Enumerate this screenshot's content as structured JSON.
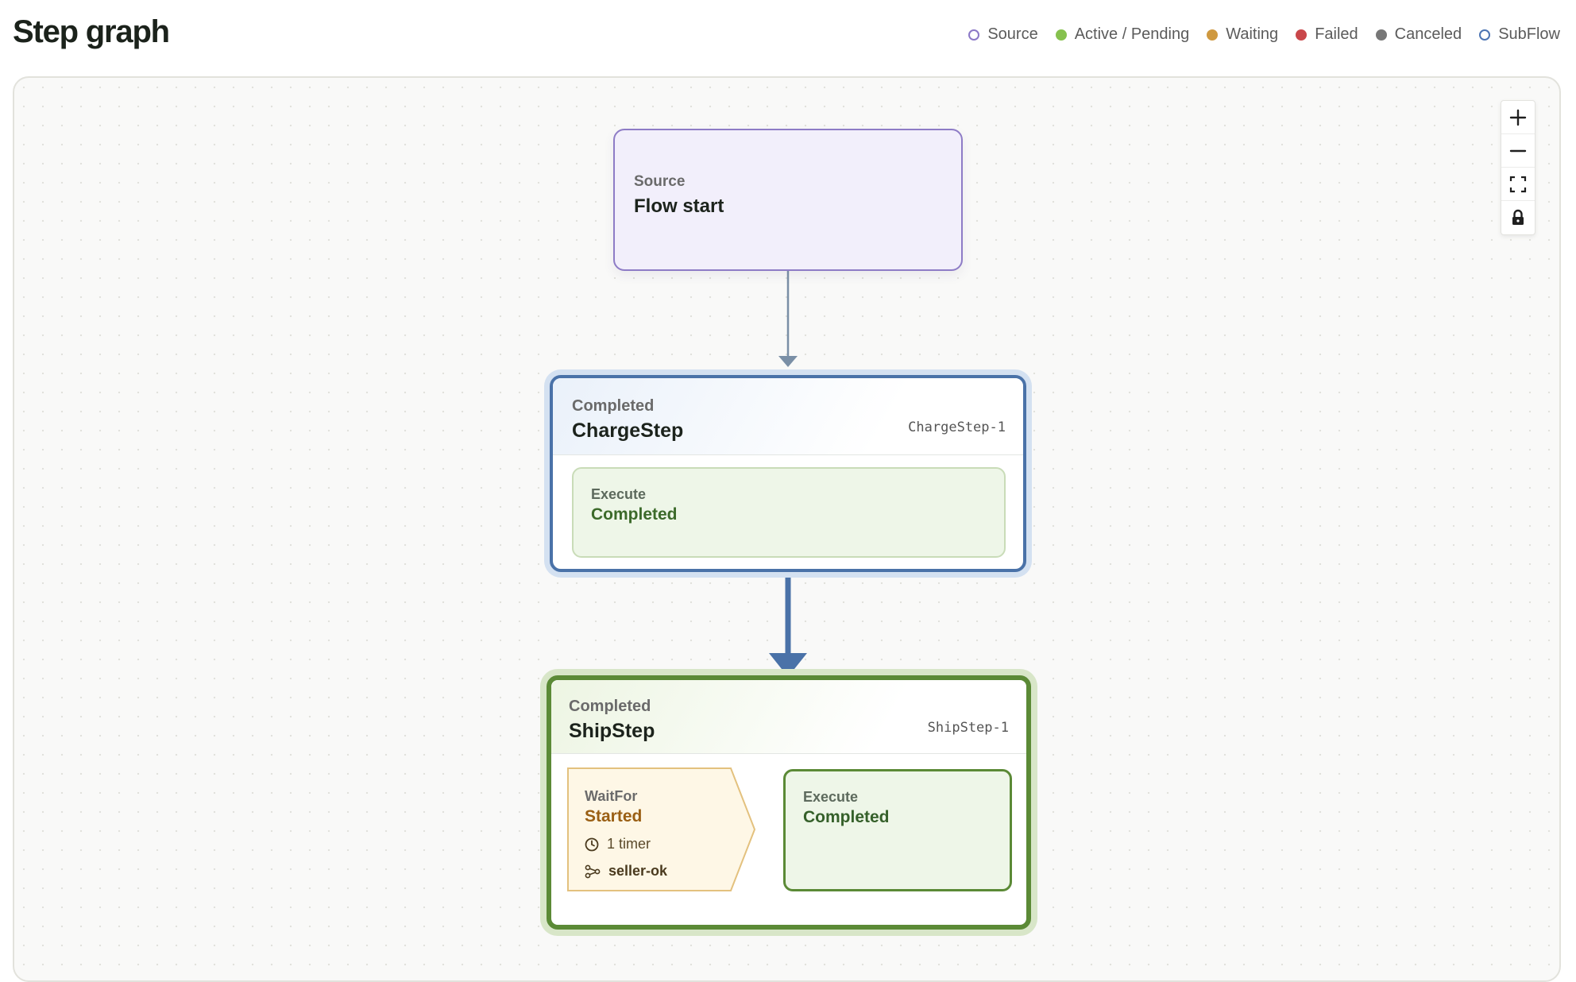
{
  "header": {
    "title": "Step graph"
  },
  "legend": [
    {
      "label": "Source",
      "color": "#8b78c7",
      "filled": false,
      "icon": "hollow-circle"
    },
    {
      "label": "Active / Pending",
      "color": "#86c14e",
      "filled": true,
      "icon": "filled-circle"
    },
    {
      "label": "Waiting",
      "color": "#cf9940",
      "filled": true,
      "icon": "filled-circle"
    },
    {
      "label": "Failed",
      "color": "#c9474a",
      "filled": true,
      "icon": "filled-circle"
    },
    {
      "label": "Canceled",
      "color": "#777777",
      "filled": true,
      "icon": "filled-circle"
    },
    {
      "label": "SubFlow",
      "color": "#4c74b3",
      "filled": false,
      "icon": "hollow-circle"
    }
  ],
  "graph": {
    "source": {
      "kicker": "Source",
      "name": "Flow start"
    },
    "charge_step": {
      "status": "Completed",
      "name": "ChargeStep",
      "id": "ChargeStep-1",
      "execute": {
        "label": "Execute",
        "state": "Completed"
      }
    },
    "ship_step": {
      "status": "Completed",
      "name": "ShipStep",
      "id": "ShipStep-1",
      "wait_for": {
        "label": "WaitFor",
        "state": "Started",
        "timers": "1 timer",
        "signal": "seller-ok"
      },
      "execute": {
        "label": "Execute",
        "state": "Completed"
      }
    }
  },
  "controls": {
    "zoom_in": "plus-icon",
    "zoom_out": "minus-icon",
    "fit_view": "fullscreen-icon",
    "lock": "lock-icon"
  },
  "colors": {
    "source_border": "#8e7cc6",
    "subflow_border": "#4a72a8",
    "completed_border": "#5b8a36",
    "waiting_fill": "#fef7e6",
    "waiting_border": "#e3c17e"
  }
}
